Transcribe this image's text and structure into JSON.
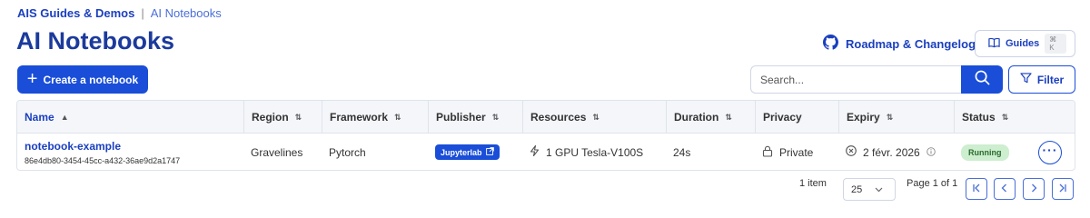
{
  "breadcrumb": {
    "root": "AIS Guides & Demos",
    "separator": "|",
    "current": "AI Notebooks"
  },
  "page_title": "AI Notebooks",
  "header": {
    "roadmap_label": "Roadmap & Changelog",
    "guides_label": "Guides",
    "guides_shortcut": "⌘ K"
  },
  "toolbar": {
    "create_label": "Create a notebook",
    "search_placeholder": "Search...",
    "filter_label": "Filter"
  },
  "table": {
    "columns": [
      "Name",
      "Region",
      "Framework",
      "Publisher",
      "Resources",
      "Duration",
      "Privacy",
      "Expiry",
      "Status"
    ],
    "rows": [
      {
        "name": "notebook-example",
        "id": "86e4db80-3454-45cc-a432-36ae9d2a1747",
        "region": "Gravelines",
        "framework": "Pytorch",
        "publisher": "Jupyterlab",
        "resources": "1 GPU Tesla-V100S",
        "duration": "24s",
        "privacy": "Private",
        "expiry": "2 févr. 2026",
        "status": "Running",
        "more_label": "···"
      }
    ]
  },
  "pagination": {
    "count": "1 item",
    "per_page": "25",
    "page_info": "Page 1 of 1"
  },
  "colors": {
    "accent": "#1a4ed8",
    "title": "#1b3a9c",
    "status_bg": "#cdeecf",
    "status_text": "#2a6b2f"
  }
}
